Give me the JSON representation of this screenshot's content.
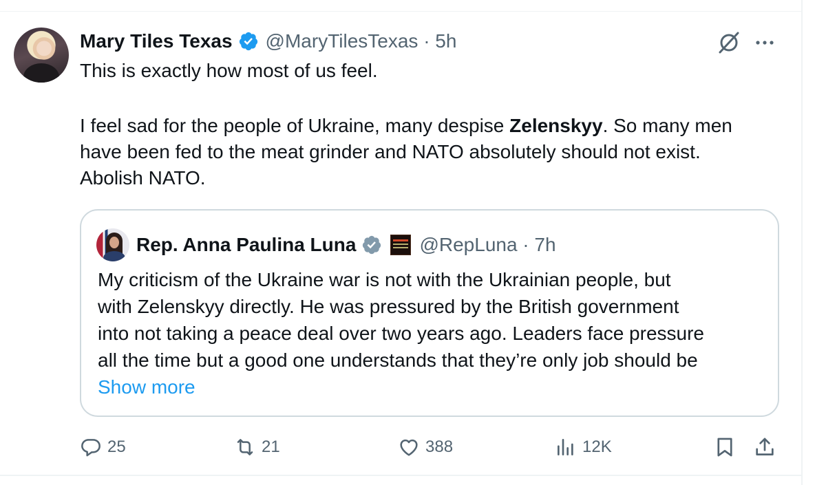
{
  "tweet": {
    "author_name": "Mary Tiles Texas",
    "handle_time": "@MaryTilesTexas · 5h",
    "lines": [
      "This is exactly how most of us feel.",
      "I feel sad for the people of Ukraine, many despise ",
      "Zelenskyy",
      ". So many men",
      "have been fed to the meat grinder and NATO absolutely  should not exist.",
      "Abolish NATO."
    ]
  },
  "quoted": {
    "author_name": "Rep. Anna Paulina Luna",
    "handle_time": "@RepLuna · 7h",
    "lines": [
      "My criticism of the Ukraine war is not with the Ukrainian people, but",
      "with Zelenskyy directly. He was pressured by the British government",
      "into not taking a peace deal over two years ago. Leaders face pressure",
      "all the time but a good one understands that they’re only job should be"
    ],
    "show_more": "Show more"
  },
  "actions": {
    "replies": "25",
    "reposts": "21",
    "likes": "388",
    "views": "12K"
  },
  "colors": {
    "text": "#0f1419",
    "muted": "#536471",
    "link": "#1d9bf0",
    "verified": "#1d9bf0",
    "border": "#cfd9de"
  }
}
